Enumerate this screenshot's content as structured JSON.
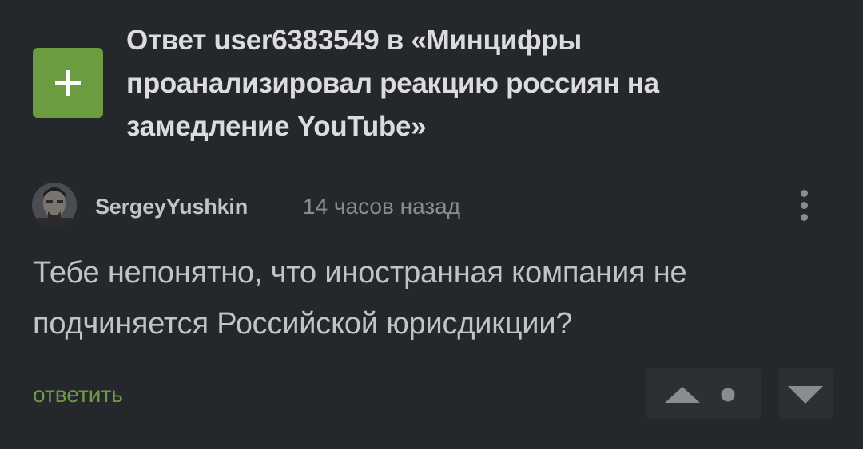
{
  "post": {
    "title": "Ответ user6383549 в «Минцифры проанализировал реакцию россиян на замедление YouTube»",
    "expand_icon": "plus-icon"
  },
  "comment": {
    "author": "SergeyYushkin",
    "time": "14 часов назад",
    "text": "Тебе непонятно, что иностранная компания не подчиняется Российской юрисдикции?",
    "reply_label": "ответить",
    "more_icon": "vertical-dots-icon"
  },
  "colors": {
    "background": "#24272b",
    "accent_green": "#6c9c40",
    "text_primary": "#dcdcdc",
    "text_secondary": "#8a8c8f",
    "vote_box": "#2c2f33"
  },
  "votes": {
    "up_icon": "triangle-up-icon",
    "rating_icon": "dot-icon",
    "down_icon": "triangle-down-icon"
  }
}
